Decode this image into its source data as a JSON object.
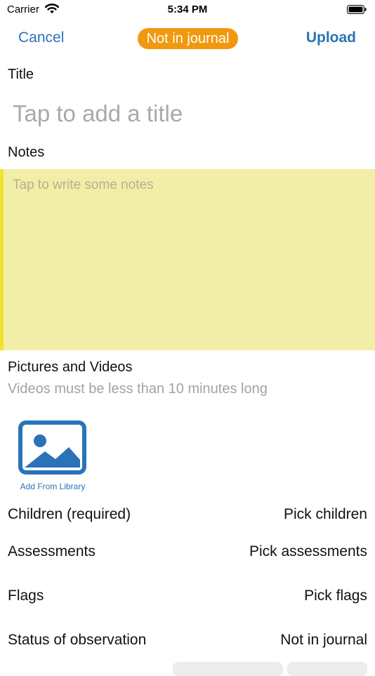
{
  "status_bar": {
    "carrier": "Carrier",
    "time": "5:34 PM"
  },
  "nav": {
    "cancel": "Cancel",
    "badge": "Not in journal",
    "upload": "Upload",
    "badge_color": "#f0990f",
    "accent": "#2a73b8"
  },
  "title_section": {
    "label": "Title",
    "placeholder": "Tap to add a title"
  },
  "notes_section": {
    "label": "Notes",
    "placeholder": "Tap to write some notes",
    "background": "#f3eea7"
  },
  "media": {
    "label": "Pictures and Videos",
    "note": "Videos must be less than 10 minutes long",
    "add_icon": "photo-library-icon",
    "add_label": "Add From Library"
  },
  "rows": [
    {
      "label": "Children (required)",
      "value": "Pick children"
    },
    {
      "label": "Assessments",
      "value": "Pick assessments"
    },
    {
      "label": "Flags",
      "value": "Pick flags"
    },
    {
      "label": "Status of observation",
      "value": "Not in journal"
    }
  ]
}
